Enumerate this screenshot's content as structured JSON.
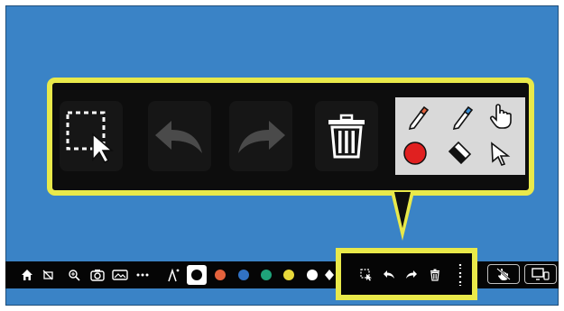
{
  "callout": {
    "tools": [
      {
        "name": "select-icon"
      },
      {
        "name": "undo-icon"
      },
      {
        "name": "redo-icon"
      },
      {
        "name": "trash-icon"
      }
    ],
    "pen_panel": [
      {
        "name": "pen-orange-icon"
      },
      {
        "name": "pen-blue-icon"
      },
      {
        "name": "hand-pointer-icon"
      },
      {
        "name": "color-red-swatch",
        "color": "#e02020"
      },
      {
        "name": "eraser-icon"
      },
      {
        "name": "arrow-cursor-icon"
      }
    ]
  },
  "bottom_bar": {
    "left_icons": [
      "home-icon",
      "no-camera-icon",
      "zoom-icon",
      "camera-icon",
      "gallery-icon",
      "more-icon"
    ],
    "colors": [
      "#e8e8e8",
      "#e4623c",
      "#3172c4",
      "#1fa37a",
      "#e8d83a",
      "#ffffff"
    ],
    "toolbox": [
      "select-icon",
      "undo-icon",
      "redo-icon",
      "trash-icon",
      "grip-icon"
    ],
    "right_buttons": [
      "touch-icon",
      "display-icon"
    ]
  },
  "colors": {
    "background": "#3a83c6",
    "highlight": "#e9e94a",
    "toolbar": "#050505"
  }
}
